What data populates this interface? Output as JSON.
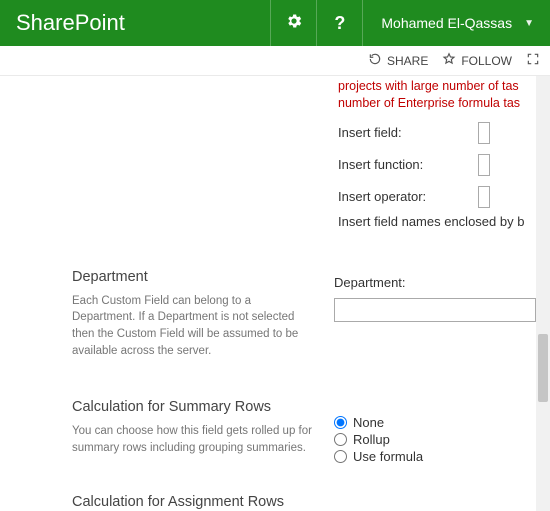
{
  "header": {
    "brand": "SharePoint",
    "user": "Mohamed El-Qassas"
  },
  "actionbar": {
    "share": "SHARE",
    "follow": "FOLLOW"
  },
  "warning_lines": "projects with large number of tas\nnumber of Enterprise formula tas",
  "formula": {
    "insert_field": "Insert field:",
    "insert_function": "Insert function:",
    "insert_operator": "Insert operator:",
    "hint": "Insert field names enclosed by b"
  },
  "department": {
    "title": "Department",
    "desc": "Each Custom Field can belong to a Department. If a Department is not selected then the Custom Field will be assumed to be available across the server.",
    "label": "Department:"
  },
  "calc_summary": {
    "title": "Calculation for Summary Rows",
    "desc": "You can choose how this field gets rolled up for summary rows including grouping summaries.",
    "options": {
      "none": "None",
      "rollup": "Rollup",
      "formula": "Use formula"
    }
  },
  "calc_assign": {
    "title": "Calculation for Assignment Rows"
  }
}
